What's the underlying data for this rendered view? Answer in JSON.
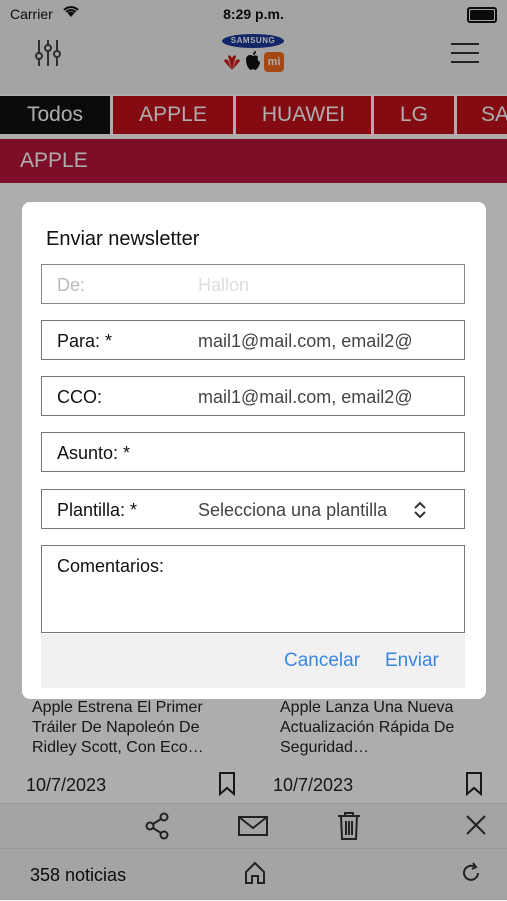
{
  "status_bar": {
    "carrier": "Carrier",
    "time": "8:29 p.m."
  },
  "header": {
    "logo_samsung": "SAMSUNG",
    "logo_mi": "mi",
    "icons": [
      "sliders-icon",
      "menu-icon"
    ]
  },
  "tabs": [
    {
      "label": "Todos",
      "active": true
    },
    {
      "label": "APPLE",
      "active": false
    },
    {
      "label": "HUAWEI",
      "active": false
    },
    {
      "label": "LG",
      "active": false
    },
    {
      "label": "SA",
      "active": false
    }
  ],
  "section": {
    "title": "APPLE"
  },
  "articles": [
    {
      "title": "Apple Estrena El Primer Tráiler De Napoleón De Ridley Scott, Con Eco…",
      "date": "10/7/2023"
    },
    {
      "title": "Apple Lanza Una Nueva Actualización Rápida De Seguridad…",
      "date": "10/7/2023"
    }
  ],
  "dialog": {
    "title": "Enviar newsletter",
    "fields": {
      "de": {
        "label": "De:",
        "value": "Hallon"
      },
      "para": {
        "label": "Para: *",
        "placeholder": "mail1@mail.com, email2@"
      },
      "cco": {
        "label": "CCO:",
        "placeholder": "mail1@mail.com, email2@"
      },
      "asunto": {
        "label": "Asunto: *",
        "value": ""
      },
      "plantilla": {
        "label": "Plantilla: *",
        "value": "Selecciona una plantilla"
      }
    },
    "comments": {
      "label": "Comentarios:"
    },
    "cancel_label": "Cancelar",
    "send_label": "Enviar"
  },
  "bottom_bar": {
    "count": "358 noticias"
  },
  "colors": {
    "accent": "#c4111b",
    "section": "#b8163a",
    "link": "#3a86e0"
  }
}
